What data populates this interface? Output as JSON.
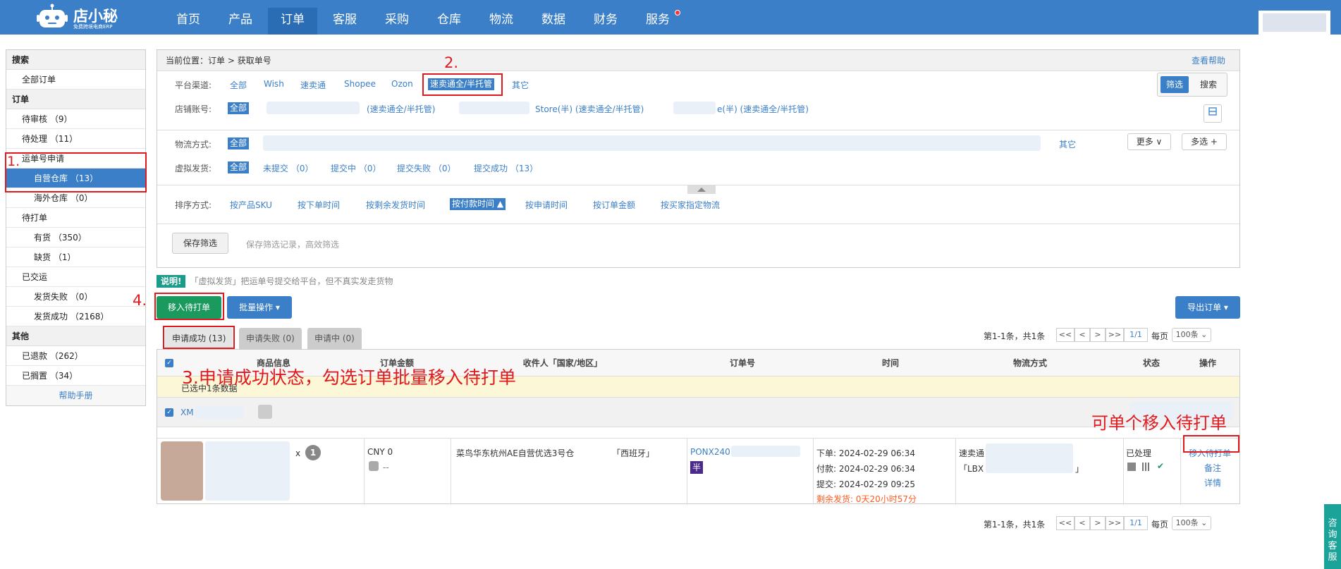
{
  "header": {
    "logo_name": "店小秘",
    "logo_sub": "免费跨境电商ERP",
    "nav": [
      "首页",
      "产品",
      "订单",
      "客服",
      "采购",
      "仓库",
      "物流",
      "数据",
      "财务",
      "服务"
    ],
    "active_nav": "订单"
  },
  "sidebar": {
    "s1": "搜索",
    "i1": "全部订单",
    "s2": "订单",
    "i2": "待审核 （9）",
    "i3": "待处理 （11）",
    "i4": "运单号申请",
    "i5": "自营仓库 （13）",
    "i6": "海外仓库 （0）",
    "i7": "待打单",
    "i8": "有货 （350）",
    "i9": "缺货 （1）",
    "i10": "已交运",
    "i11": "发货失败 （0）",
    "i12": "发货成功 （2168）",
    "s3": "其他",
    "i13": "已退款 （262）",
    "i14": "已搁置 （34）",
    "footer": "帮助手册"
  },
  "crumb": {
    "label": "当前位置：",
    "path": "订单 > 获取单号",
    "help": "查看帮助"
  },
  "filters": {
    "platform_label": "平台渠道:",
    "platforms": [
      "全部",
      "Wish",
      "速卖通",
      "Shopee",
      "Ozon",
      "速卖通全/半托管",
      "其它"
    ],
    "shop_label": "店铺账号:",
    "shop_all": "全部",
    "shop1": "(速卖通全/半托管)",
    "shop2": "Store(半) (速卖通全/半托管)",
    "shop3": "e(半) (速卖通全/半托管)",
    "screen_btn": "筛选",
    "search_btn": "搜索",
    "logistics_label": "物流方式:",
    "logistics_all": "全部",
    "logistics_other": "其它",
    "more": "更多 ∨",
    "multi": "多选 +",
    "virtual_label": "虚拟发货:",
    "virtual_all": "全部",
    "virtual": [
      "未提交 （0）",
      "提交中 （0）",
      "提交失败 （0）",
      "提交成功 （13）"
    ],
    "sort_label": "排序方式:",
    "sorts": [
      "按产品SKU",
      "按下单时间",
      "按剩余发货时间",
      "按付款时间 ▲",
      "按申请时间",
      "按订单金额",
      "按买家指定物流"
    ],
    "save_btn": "保存筛选",
    "save_hint": "保存筛选记录，高效筛选"
  },
  "note": {
    "badge": "说明!",
    "text": "「虚拟发货」把运单号提交给平台，但不真实发走货物"
  },
  "actions": {
    "move_btn": "移入待打单",
    "batch_btn": "批量操作 ▾",
    "export_btn": "导出订单 ▾"
  },
  "tabs": [
    "申请成功 (13)",
    "申请失败 (0)",
    "申请中 (0)"
  ],
  "pagination": {
    "summary": "第1-1条，共1条",
    "first": "<<",
    "prev": "<",
    "next": ">",
    "last": ">>",
    "page": "1/1",
    "per_label": "每页",
    "per_value": "100条 ⌄"
  },
  "table": {
    "headers": [
      "商品信息",
      "订单金额",
      "收件人「国家/地区」",
      "订单号",
      "时间",
      "物流方式",
      "状态",
      "操作"
    ],
    "selected_msg": "已选中1条数据",
    "group_prefix": "XM",
    "qty_x": "x",
    "qty": "1",
    "amount": "CNY 0",
    "profit": "--",
    "recipient": "菜鸟华东杭州AE自营优选3号仓",
    "country": "「西班牙」",
    "order_no": "PONX240",
    "half_tag": "半",
    "t1": "下单: 2024-02-29 06:34",
    "t2": "付款: 2024-02-29 06:34",
    "t3": "提交: 2024-02-29 09:25",
    "t4": "剩余发货: 0天20小时57分",
    "logistics1": "速卖通",
    "logistics2": "「LBX",
    "logistics3": "」",
    "status": "已处理",
    "op1": "移入待打单",
    "op2": "备注",
    "op3": "详情"
  },
  "annotations": {
    "a1": "1.",
    "a2": "2.",
    "a3": "3.申请成功状态，勾选订单批量移入待打单",
    "a4": "4.",
    "a5": "可单个移入待打单"
  },
  "kefu": "咨询客服"
}
